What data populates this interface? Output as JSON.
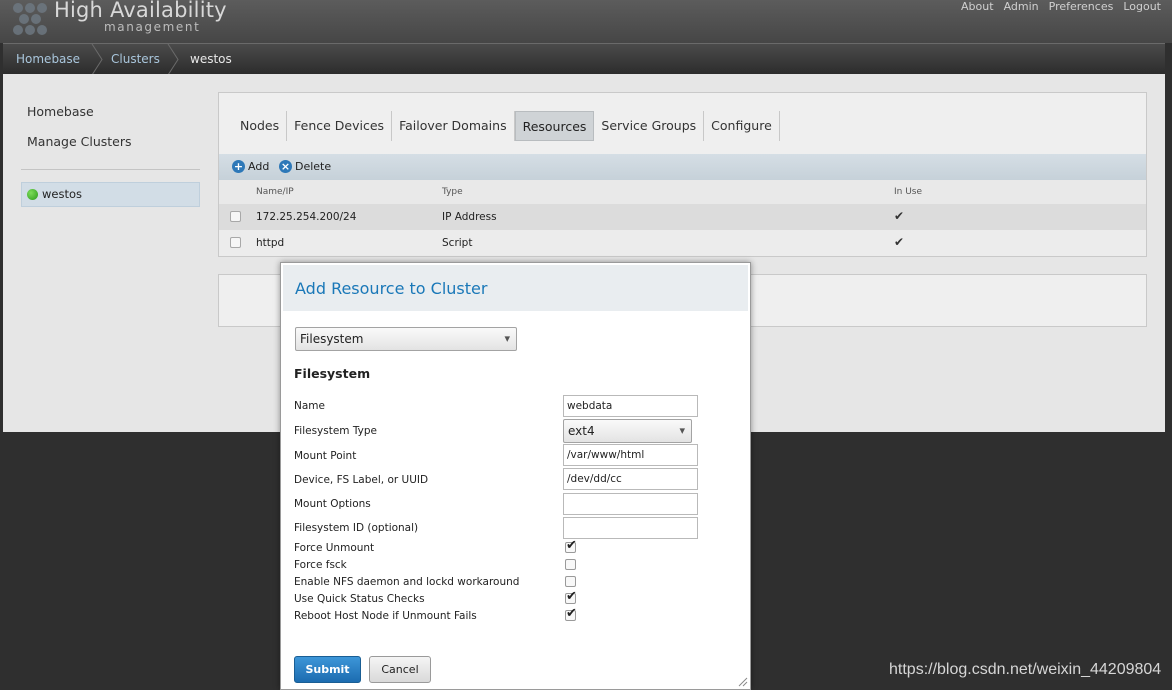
{
  "header": {
    "title": "High Availability",
    "subtitle": "management",
    "nav": [
      "About",
      "Admin",
      "Preferences",
      "Logout"
    ]
  },
  "breadcrumb": [
    "Homebase",
    "Clusters",
    "westos"
  ],
  "sidebar": {
    "homebase": "Homebase",
    "manage_clusters": "Manage Clusters",
    "cluster": "westos"
  },
  "tabs": [
    "Nodes",
    "Fence Devices",
    "Failover Domains",
    "Resources",
    "Service Groups",
    "Configure"
  ],
  "toolbar": {
    "add": "Add",
    "delete": "Delete"
  },
  "table": {
    "headers": [
      "Name/IP",
      "Type",
      "In Use"
    ],
    "rows": [
      {
        "name": "172.25.254.200/24",
        "type": "IP Address",
        "in_use": true
      },
      {
        "name": "httpd",
        "type": "Script",
        "in_use": true
      }
    ]
  },
  "modal": {
    "title": "Add Resource to Cluster",
    "resource_type": "Filesystem",
    "section_title": "Filesystem",
    "fields": {
      "name": {
        "label": "Name",
        "value": "webdata"
      },
      "fs_type": {
        "label": "Filesystem Type",
        "value": "ext4"
      },
      "mount_point": {
        "label": "Mount Point",
        "value": "/var/www/html"
      },
      "device": {
        "label": "Device, FS Label, or UUID",
        "value": "/dev/dd/cc"
      },
      "mount_options": {
        "label": "Mount Options",
        "value": ""
      },
      "fs_id": {
        "label": "Filesystem ID (optional)",
        "value": ""
      }
    },
    "checkboxes": {
      "force_unmount": {
        "label": "Force Unmount",
        "checked": true
      },
      "force_fsck": {
        "label": "Force fsck",
        "checked": false
      },
      "nfs_workaround": {
        "label": "Enable NFS daemon and lockd workaround",
        "checked": false
      },
      "quick_status": {
        "label": "Use Quick Status Checks",
        "checked": true
      },
      "reboot_host": {
        "label": "Reboot Host Node if Unmount Fails",
        "checked": true
      }
    },
    "submit": "Submit",
    "cancel": "Cancel"
  },
  "watermark": "https://blog.csdn.net/weixin_44209804",
  "colors": {
    "accent": "#1a78b8",
    "status_online": "#2b9a1b",
    "submit": "#1c6cb0"
  }
}
